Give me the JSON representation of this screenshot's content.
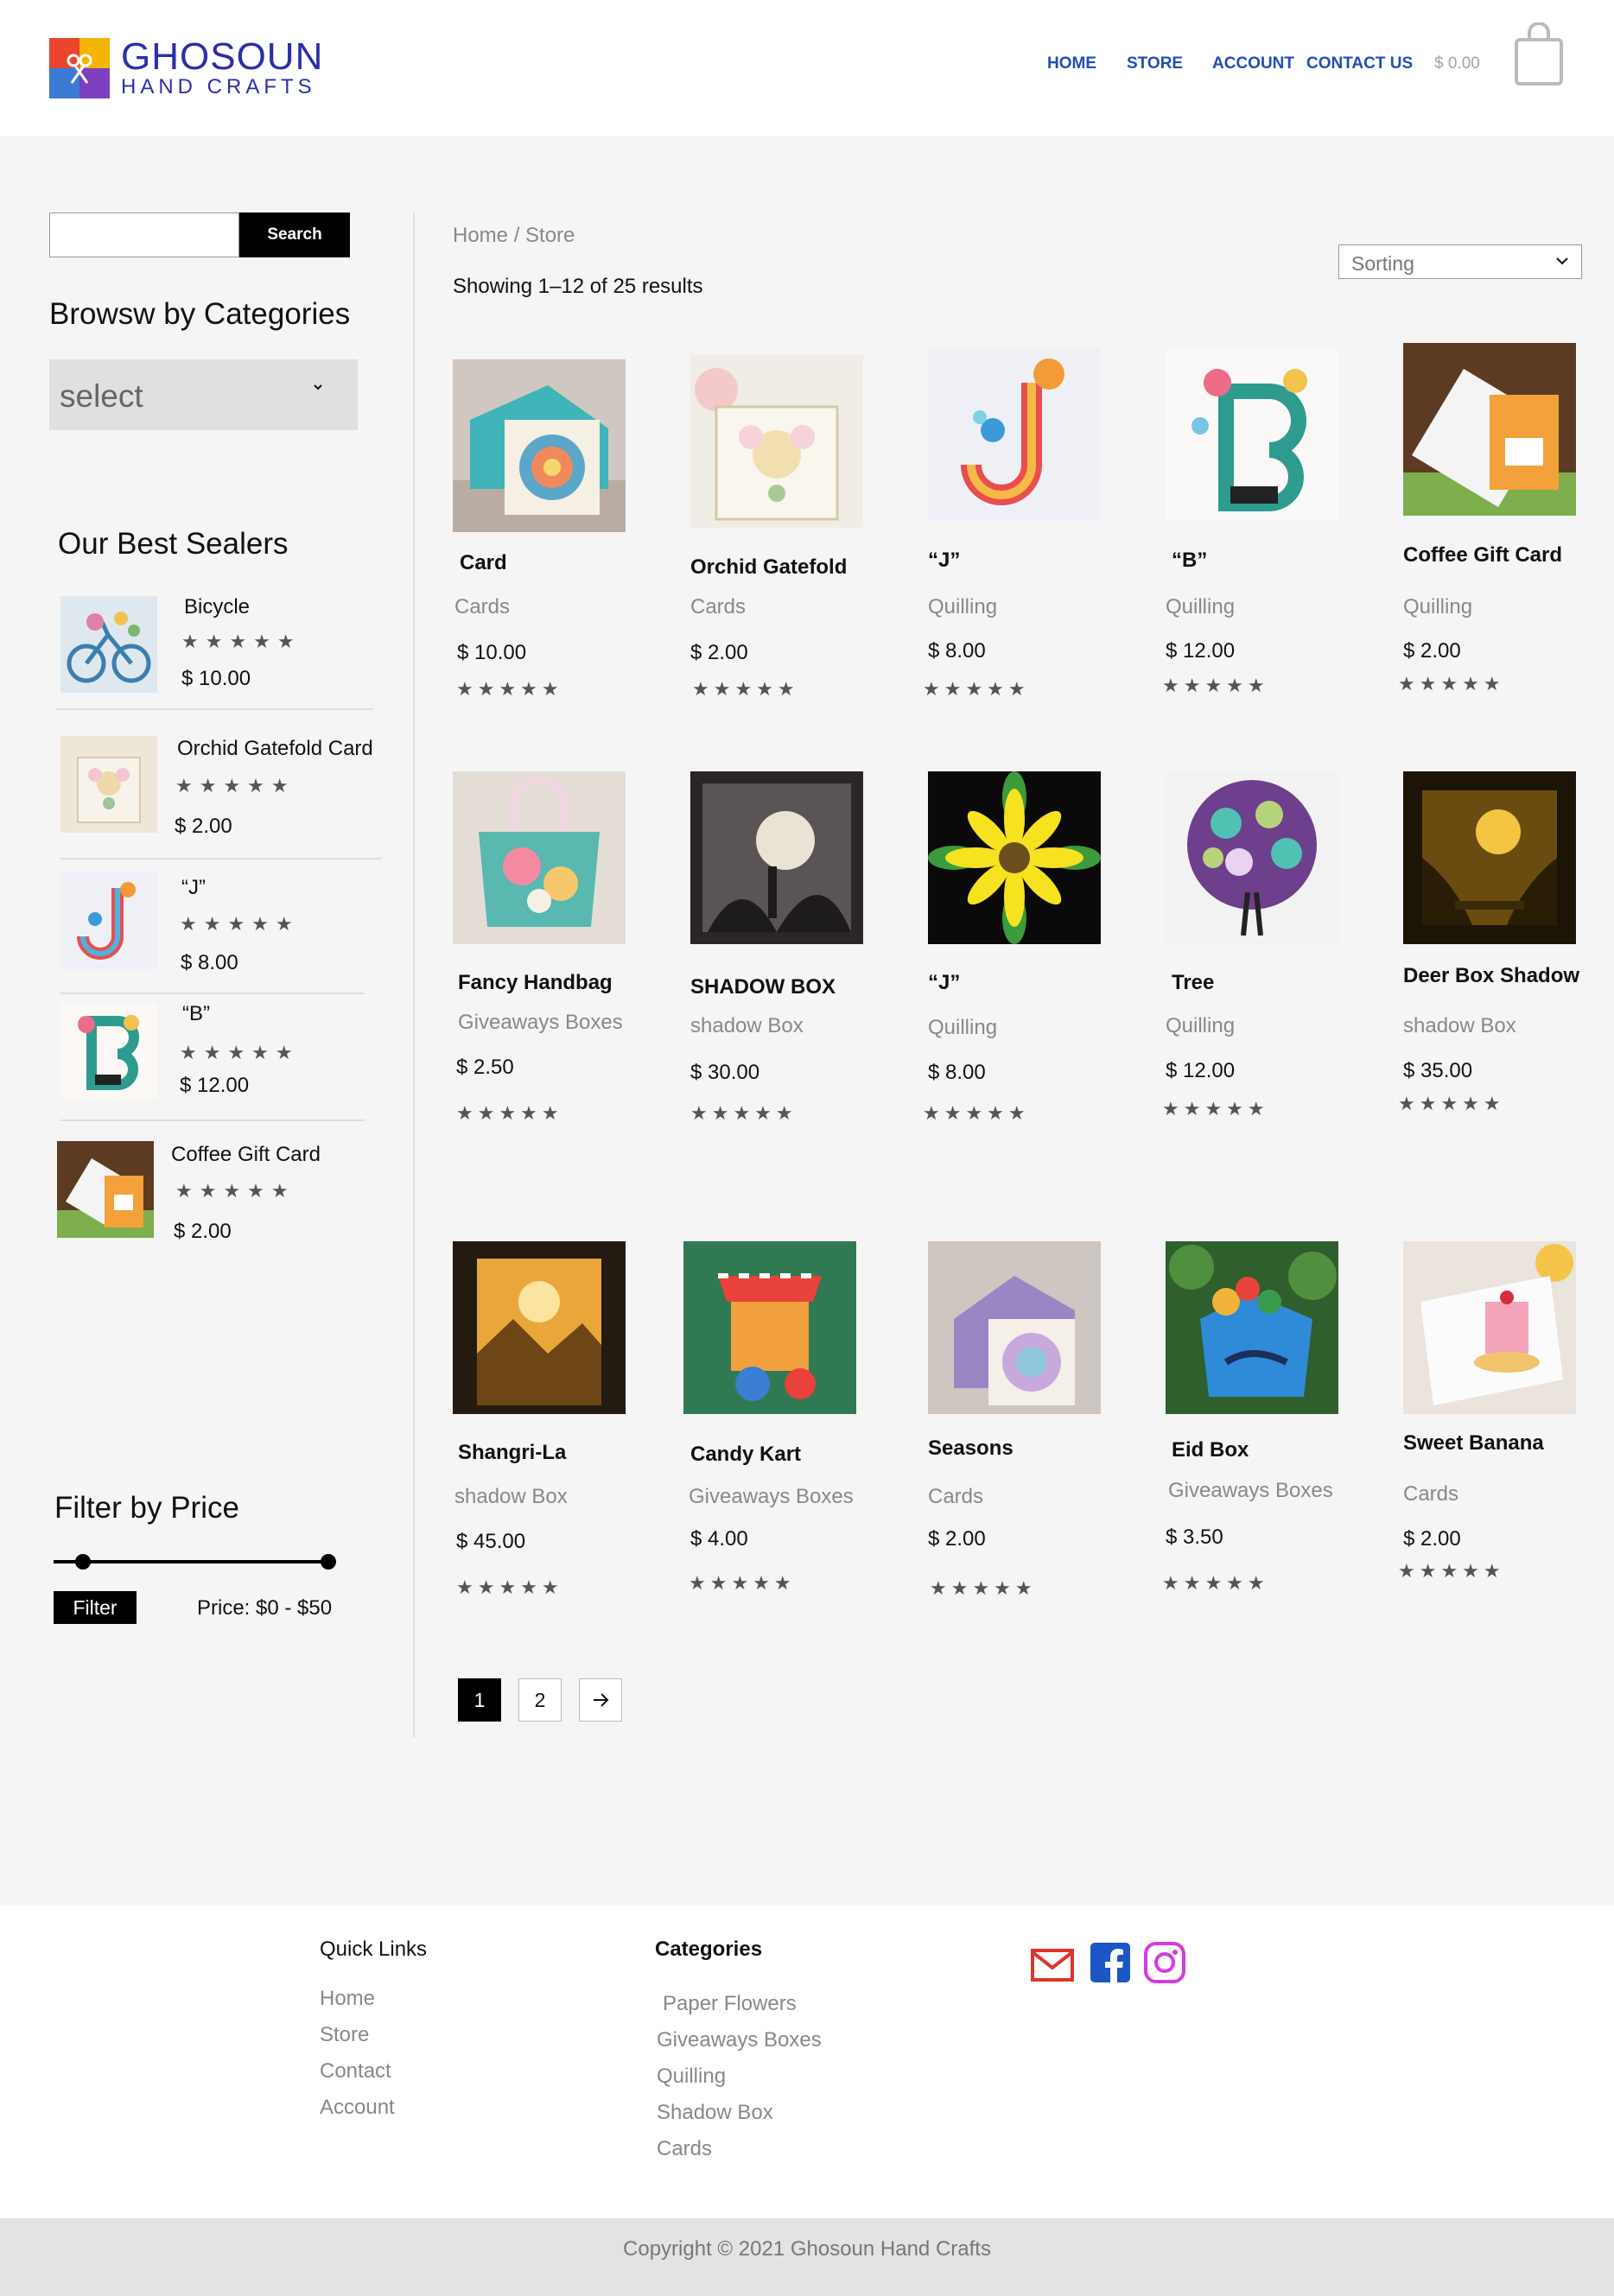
{
  "brand": {
    "name": "GHOSOUN",
    "tagline": "HAND CRAFTS"
  },
  "nav": {
    "home": "HOME",
    "store": "STORE",
    "account": "ACCOUNT",
    "contact": "CONTACT US",
    "cart_total": "$ 0.00"
  },
  "sidebar": {
    "search_button": "Search",
    "categories_heading": "Browsw by Categories",
    "category_select": "select",
    "best_heading": "Our Best Sealers",
    "best": [
      {
        "name": "Bicycle",
        "stars": "★★★★★",
        "price": "$ 10.00"
      },
      {
        "name": "Orchid Gatefold Card",
        "stars": "★★★★★",
        "price": "$ 2.00"
      },
      {
        "name": "“J”",
        "stars": "★★★★★",
        "price": "$ 8.00"
      },
      {
        "name": "“B”",
        "stars": "★★★★★",
        "price": "$ 12.00"
      },
      {
        "name": "Coffee Gift Card",
        "stars": "★★★★★",
        "price": "$ 2.00"
      }
    ],
    "filter_heading": "Filter by Price",
    "filter_button": "Filter",
    "price_range": "Price: $0 - $50"
  },
  "main": {
    "breadcrumb": "Home / Store",
    "results": "Showing 1–12 of 25 results",
    "sorting": "Sorting",
    "products": [
      {
        "name": "Card",
        "category": "Cards",
        "price": "$ 10.00",
        "stars": "★★★★★"
      },
      {
        "name": "Orchid Gatefold",
        "category": "Cards",
        "price": "$ 2.00",
        "stars": "★★★★★"
      },
      {
        "name": "“J”",
        "category": "Quilling",
        "price": "$ 8.00",
        "stars": "★★★★★"
      },
      {
        "name": "“B”",
        "category": "Quilling",
        "price": "$ 12.00",
        "stars": "★★★★★"
      },
      {
        "name": "Coffee Gift Card",
        "category": "Quilling",
        "price": "$ 2.00",
        "stars": "★★★★★"
      },
      {
        "name": "Fancy Handbag",
        "category": "Giveaways Boxes",
        "price": "$ 2.50",
        "stars": "★★★★★"
      },
      {
        "name": "SHADOW BOX",
        "category": "shadow Box",
        "price": "$ 30.00",
        "stars": "★★★★★"
      },
      {
        "name": "“J”",
        "category": "Quilling",
        "price": "$ 8.00",
        "stars": "★★★★★"
      },
      {
        "name": "Tree",
        "category": "Quilling",
        "price": "$ 12.00",
        "stars": "★★★★★"
      },
      {
        "name": "Deer Box Shadow",
        "category": "shadow Box",
        "price": "$ 35.00",
        "stars": "★★★★★"
      },
      {
        "name": "Shangri-La",
        "category": "shadow Box",
        "price": "$ 45.00",
        "stars": "★★★★★"
      },
      {
        "name": "Candy Kart",
        "category": "Giveaways Boxes",
        "price": "$ 4.00",
        "stars": "★★★★★"
      },
      {
        "name": "Seasons",
        "category": "Cards",
        "price": "$ 2.00",
        "stars": "★★★★★"
      },
      {
        "name": "Eid  Box",
        "category": "Giveaways Boxes",
        "price": "$ 3.50",
        "stars": "★★★★★"
      },
      {
        "name": "Sweet Banana",
        "category": "Cards",
        "price": "$ 2.00",
        "stars": "★★★★★"
      }
    ],
    "pagination": {
      "page1": "1",
      "page2": "2"
    }
  },
  "footer": {
    "quick_links_heading": "Quick Links",
    "quick_links": [
      "Home",
      "Store",
      "Contact",
      "Account"
    ],
    "categories_heading": "Categories",
    "categories": [
      "Paper Flowers",
      "Giveaways Boxes",
      "Quilling",
      "Shadow Box",
      "Cards"
    ],
    "copyright": "Copyright © 2021 Ghosoun Hand Crafts"
  },
  "colors": {
    "brand": "#2b2ea8",
    "nav": "#1f4fb3",
    "email": "#e0342a",
    "facebook": "#1a56c4",
    "instagram": "#d63ae0"
  }
}
